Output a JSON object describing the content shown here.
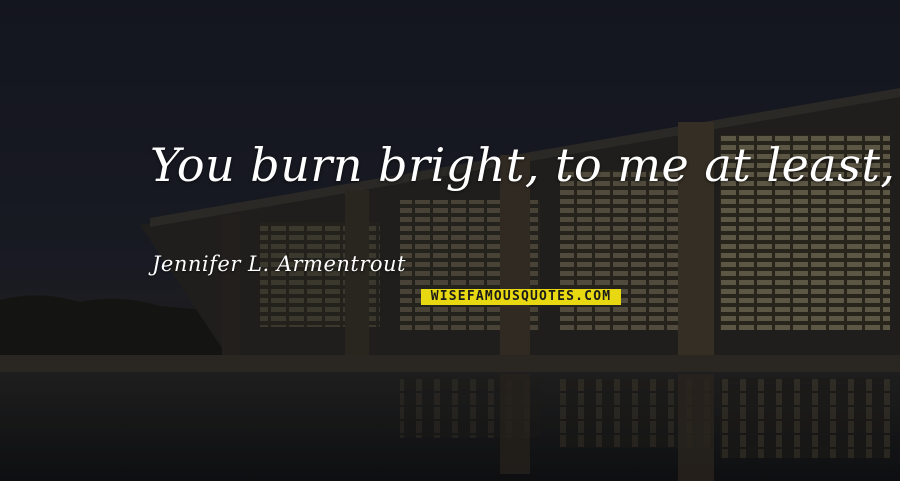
{
  "quote": {
    "text": "You burn bright, to me at least,",
    "author": "Jennifer L. Armentrout"
  },
  "watermark": {
    "text": "WISEFAMOUSQUOTES.COM"
  },
  "colors": {
    "sky": "#1c1f2b",
    "text": "#ffffff",
    "watermark_bg": "#e8d812",
    "window_glow": "#c9b887"
  }
}
